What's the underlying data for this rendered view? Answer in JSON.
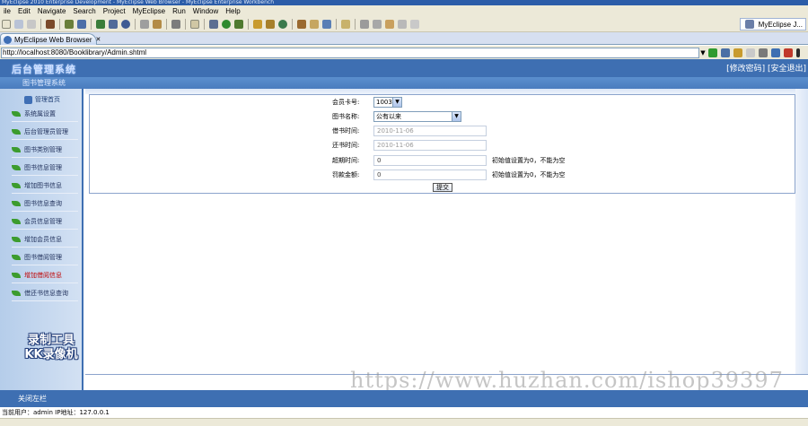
{
  "window": {
    "title": "MyEclipse 2010 Enterprise Development - MyEclipse Web Browser - MyEclipse Enterprise Workbench"
  },
  "menu": [
    "ile",
    "Edit",
    "Navigate",
    "Search",
    "Project",
    "MyEclipse",
    "Run",
    "Window",
    "Help"
  ],
  "perspective": {
    "label": "MyEclipse J..."
  },
  "browser_tab": {
    "label": "MyEclipse Web Browser",
    "close": "✕"
  },
  "address": {
    "url": "http://localhost:8080/Booklibrary/Admin.shtml"
  },
  "page": {
    "title": "后台管理系统",
    "header_links": "[修改密码] [安全退出]",
    "subheader": "图书管理系统",
    "sidebar": {
      "heading": "管理首页",
      "items": [
        {
          "label": "系统属设置",
          "hot": false
        },
        {
          "label": "后台管理员管理",
          "hot": false
        },
        {
          "label": "图书类别管理",
          "hot": false
        },
        {
          "label": "图书信息管理",
          "hot": false
        },
        {
          "label": "增加图书信息",
          "hot": false
        },
        {
          "label": "图书信息查询",
          "hot": false
        },
        {
          "label": "会员信息管理",
          "hot": false
        },
        {
          "label": "增加会员信息",
          "hot": false
        },
        {
          "label": "图书借阅管理",
          "hot": false
        },
        {
          "label": "增加借阅信息",
          "hot": true
        },
        {
          "label": "借还书信息查询",
          "hot": false
        }
      ]
    },
    "form": {
      "card_no": {
        "label": "会员卡号:",
        "value": "1003"
      },
      "book_name": {
        "label": "图书名称:",
        "value": "公有以来"
      },
      "borrow_time": {
        "label": "借书时间:",
        "value": "2010-11-06"
      },
      "return_time": {
        "label": "还书时间:",
        "value": "2010-11-06"
      },
      "overdue_time": {
        "label": "超期时间:",
        "value": "0",
        "note": "初始值设置为0，不能为空"
      },
      "fine_amount": {
        "label": "罚款金额:",
        "value": "0",
        "note": "初始值设置为0，不能为空"
      },
      "submit_label": "提交"
    },
    "footer": {
      "close_label": "关闭左栏"
    },
    "status": "当前用户：admin   IP地址：127.0.0.1"
  },
  "overlays": {
    "recorder_watermark": "录制工具\nKK录像机",
    "url_watermark": "https://www.huzhan.com/ishop39397"
  },
  "colors": {
    "header_blue": "#3e6fb2",
    "sidebar_bg": "#c4d7ef",
    "chrome_bg": "#ece9d8"
  }
}
